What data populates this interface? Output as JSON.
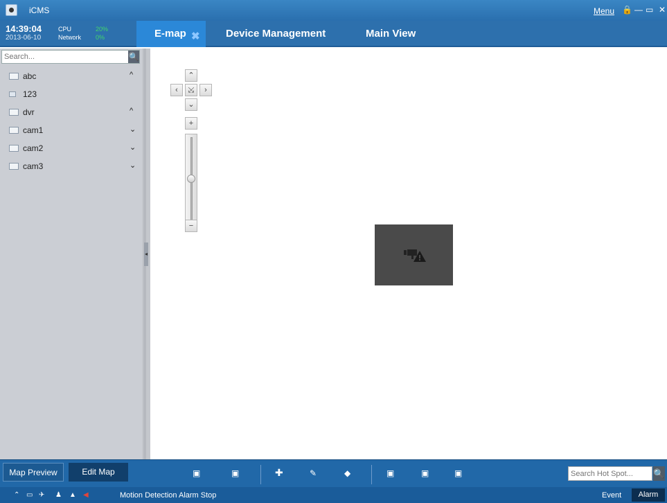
{
  "window": {
    "title": "iCMS",
    "menu": "Menu",
    "controls": [
      "🔒",
      "—",
      "▭",
      "✕"
    ]
  },
  "header": {
    "time": "14:39:04",
    "date": "2013-06-10",
    "cpu_label": "CPU",
    "cpu_value": "20%",
    "network_label": "Network",
    "network_value": "0%"
  },
  "tabs": [
    {
      "label": "E-map",
      "close": "✖"
    },
    {
      "label": "Device Management"
    },
    {
      "label": "Main View"
    }
  ],
  "sidebar": {
    "search_placeholder": "Search...",
    "search_icon": "🔍",
    "items": [
      {
        "label": "abc",
        "chevron": "^"
      },
      {
        "label": "123",
        "chevron": ""
      },
      {
        "label": "dvr",
        "chevron": "^"
      },
      {
        "label": "cam1",
        "chevron": "⌄"
      },
      {
        "label": "cam2",
        "chevron": "⌄"
      },
      {
        "label": "cam3",
        "chevron": "⌄"
      }
    ],
    "collapse_icon": "◂"
  },
  "map_controls": {
    "up": "⌃",
    "left": "‹",
    "center": "⤩",
    "right": "›",
    "down": "⌄",
    "zoom_in": "+",
    "zoom_out": "−",
    "zoom_level": 0.5
  },
  "bottom": {
    "map_preview": "Map Preview",
    "edit_map": "Edit Map",
    "tools": [
      "▣",
      "▣",
      "✚",
      "✎",
      "◆",
      "▣",
      "▣",
      "▣"
    ],
    "hotspot_placeholder": "Search Hot Spot...",
    "hotspot_icon": "🔍"
  },
  "status": {
    "icons": [
      "⌃",
      "▭",
      "✈",
      "♟",
      "▲",
      "◀"
    ],
    "message": "Motion Detection Alarm Stop",
    "event": "Event",
    "alarm": "Alarm"
  },
  "colors": {
    "titlebar": "#2d70ad",
    "active_tab": "#2b88d8",
    "bottombar": "#2168a8",
    "statusbar": "#1a5c9a",
    "sidebar": "#cbced4",
    "cpu_value": "#42d66b"
  }
}
